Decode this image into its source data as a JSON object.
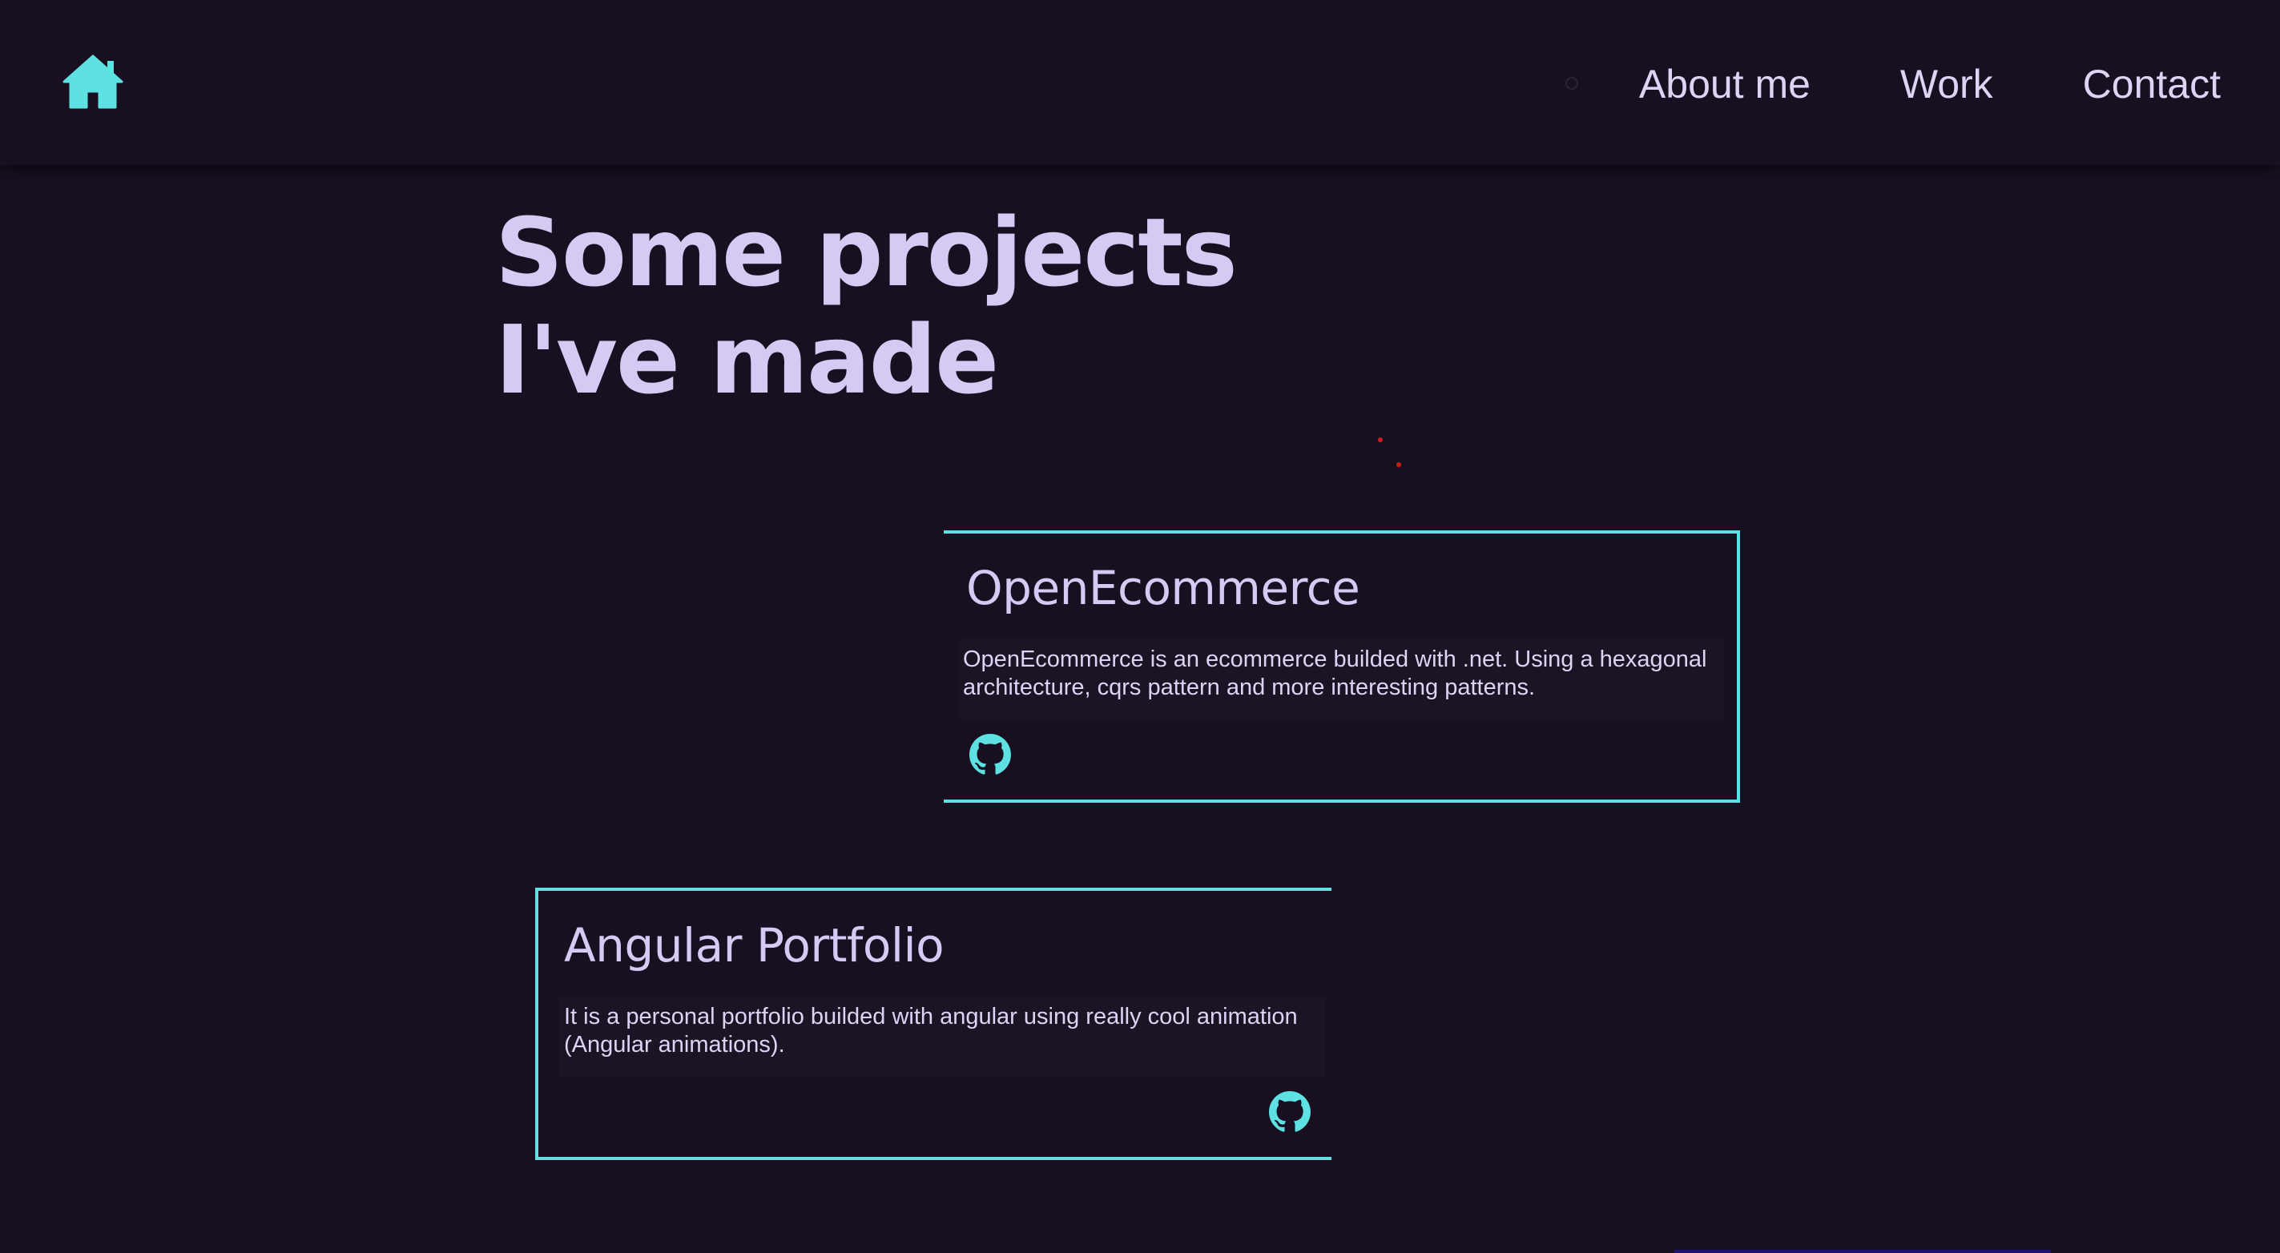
{
  "colors": {
    "background": "#181020",
    "accent": "#5ee1e2",
    "text": "#d6caf4"
  },
  "nav": {
    "home_icon": "home-icon",
    "links": [
      {
        "label": "About me"
      },
      {
        "label": "Work"
      },
      {
        "label": "Contact"
      }
    ]
  },
  "main": {
    "heading_line1": "Some projects",
    "heading_line2": "I've made",
    "projects": [
      {
        "title": "OpenEcommerce",
        "description": "OpenEcommerce is an ecommerce builded with .net. Using a hexagonal architecture, cqrs pattern and more interesting patterns.",
        "icon": "github-icon"
      },
      {
        "title": "Angular Portfolio",
        "description": "It is a personal portfolio builded with angular using really cool animation (Angular animations).",
        "icon": "github-icon"
      }
    ]
  }
}
